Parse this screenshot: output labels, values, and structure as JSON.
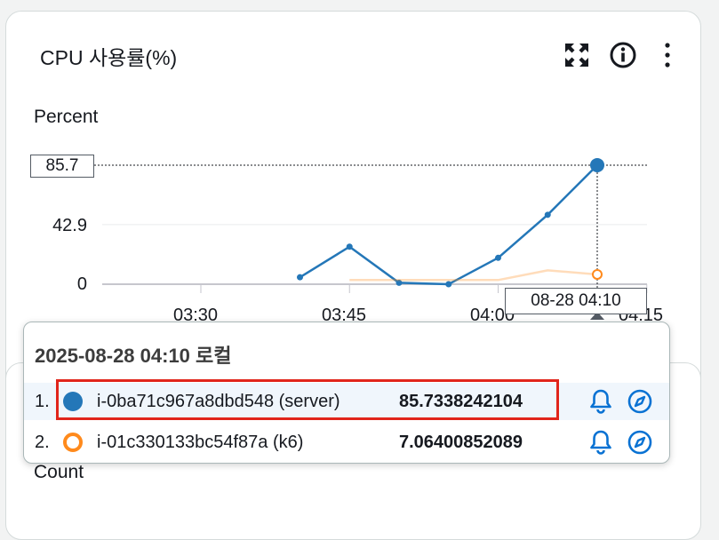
{
  "widget": {
    "title": "CPU 사용률(%)",
    "icons": [
      "fullscreen-icon",
      "info-icon",
      "more-icon"
    ]
  },
  "chart_data": {
    "type": "line",
    "ylabel": "Percent",
    "y_ticks": [
      "85.7",
      "42.9",
      "0"
    ],
    "x_ticks": [
      "03:30",
      "03:45",
      "04:00",
      "04:15"
    ],
    "ylim": [
      0,
      85.7
    ],
    "highlight_y": "85.7",
    "highlight_x": "08-28 04:10",
    "x": [
      "03:40",
      "03:45",
      "03:50",
      "03:55",
      "04:00",
      "04:05",
      "04:10"
    ],
    "series": [
      {
        "name": "i-0ba71c967a8dbd548 (server)",
        "color": "#2477b8",
        "values": [
          5,
          27,
          1,
          0,
          19,
          50,
          85.73
        ]
      },
      {
        "name": "i-01c330133bc54f87a (k6)",
        "color": "#ff8a1c",
        "values": [
          null,
          3,
          3,
          3,
          3,
          10,
          7.06
        ]
      }
    ]
  },
  "tooltip": {
    "title": "2025-08-28 04:10 로컬",
    "rows": [
      {
        "index": "1.",
        "name": "i-0ba71c967a8dbd548 (server)",
        "value": "85.7338242104",
        "color": "#2477b8",
        "filled": true
      },
      {
        "index": "2.",
        "name": "i-01c330133bc54f87a (k6)",
        "value": "7.06400852089",
        "color": "#ff8a1c",
        "filled": false
      }
    ]
  },
  "next_widget": {
    "ylabel": "Count"
  }
}
